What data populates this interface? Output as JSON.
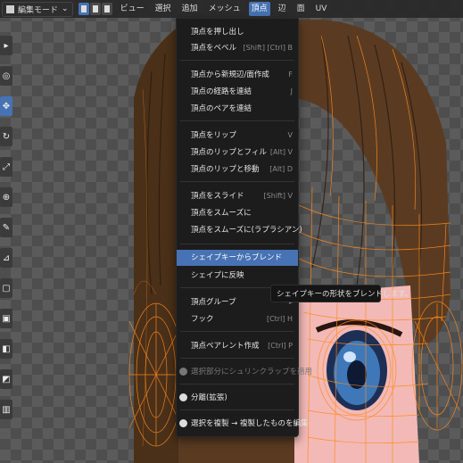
{
  "header": {
    "mode_label": "編集モード",
    "menus": [
      {
        "label": "ビュー"
      },
      {
        "label": "選択"
      },
      {
        "label": "追加"
      },
      {
        "label": "メッシュ"
      },
      {
        "label": "頂点"
      },
      {
        "label": "辺"
      },
      {
        "label": "面"
      },
      {
        "label": "UV"
      }
    ],
    "active_menu": "頂点"
  },
  "toolbar": {
    "tools": [
      {
        "icon": "select-cursor-icon"
      },
      {
        "icon": "cursor-icon"
      },
      {
        "icon": "move-icon"
      },
      {
        "icon": "rotate-icon"
      },
      {
        "icon": "scale-icon"
      },
      {
        "icon": "transform-icon"
      },
      {
        "icon": "annotate-icon"
      },
      {
        "icon": "measure-icon"
      },
      {
        "icon": "add-cube-icon"
      },
      {
        "icon": "extrude-icon"
      },
      {
        "icon": "inset-icon"
      },
      {
        "icon": "bevel-icon"
      },
      {
        "icon": "loop-cut-icon"
      }
    ]
  },
  "vertex_menu": {
    "items": [
      {
        "label": "頂点を押し出し",
        "shortcut": ""
      },
      {
        "label": "頂点をベベル",
        "shortcut": "[Shift] [Ctrl] B"
      },
      {
        "label": "頂点から新規辺/面作成",
        "shortcut": "F"
      },
      {
        "label": "頂点の経路を連結",
        "shortcut": "J"
      },
      {
        "label": "頂点のペアを連結",
        "shortcut": ""
      },
      {
        "label": "頂点をリップ",
        "shortcut": "V"
      },
      {
        "label": "頂点のリップとフィル",
        "shortcut": "[Alt] V"
      },
      {
        "label": "頂点のリップと移動",
        "shortcut": "[Alt] D"
      },
      {
        "label": "頂点をスライド",
        "shortcut": "[Shift] V"
      },
      {
        "label": "頂点をスムーズに",
        "shortcut": ""
      },
      {
        "label": "頂点をスムーズに(ラプラシアン)",
        "shortcut": ""
      },
      {
        "label": "シェイプキーからブレンド",
        "shortcut": ""
      },
      {
        "label": "シェイプに反映",
        "shortcut": ""
      },
      {
        "label": "頂点グループ",
        "shortcut": ""
      },
      {
        "label": "フック",
        "shortcut": "[Ctrl] H"
      },
      {
        "label": "頂点ペアレント作成",
        "shortcut": "[Ctrl] P"
      },
      {
        "label": "選択部分にシュリンクラップを適用",
        "shortcut": ""
      },
      {
        "label": "分離(拡張)",
        "shortcut": ""
      },
      {
        "label": "選択を複製 → 複製したものを編集",
        "shortcut": ""
      }
    ]
  },
  "tooltip": {
    "text": "シェイプキーの形状をブレンドします。"
  },
  "colors": {
    "accent": "#4772b3",
    "menu_bg": "#1c1c1c",
    "mesh_wire": "#ff8a1c"
  }
}
